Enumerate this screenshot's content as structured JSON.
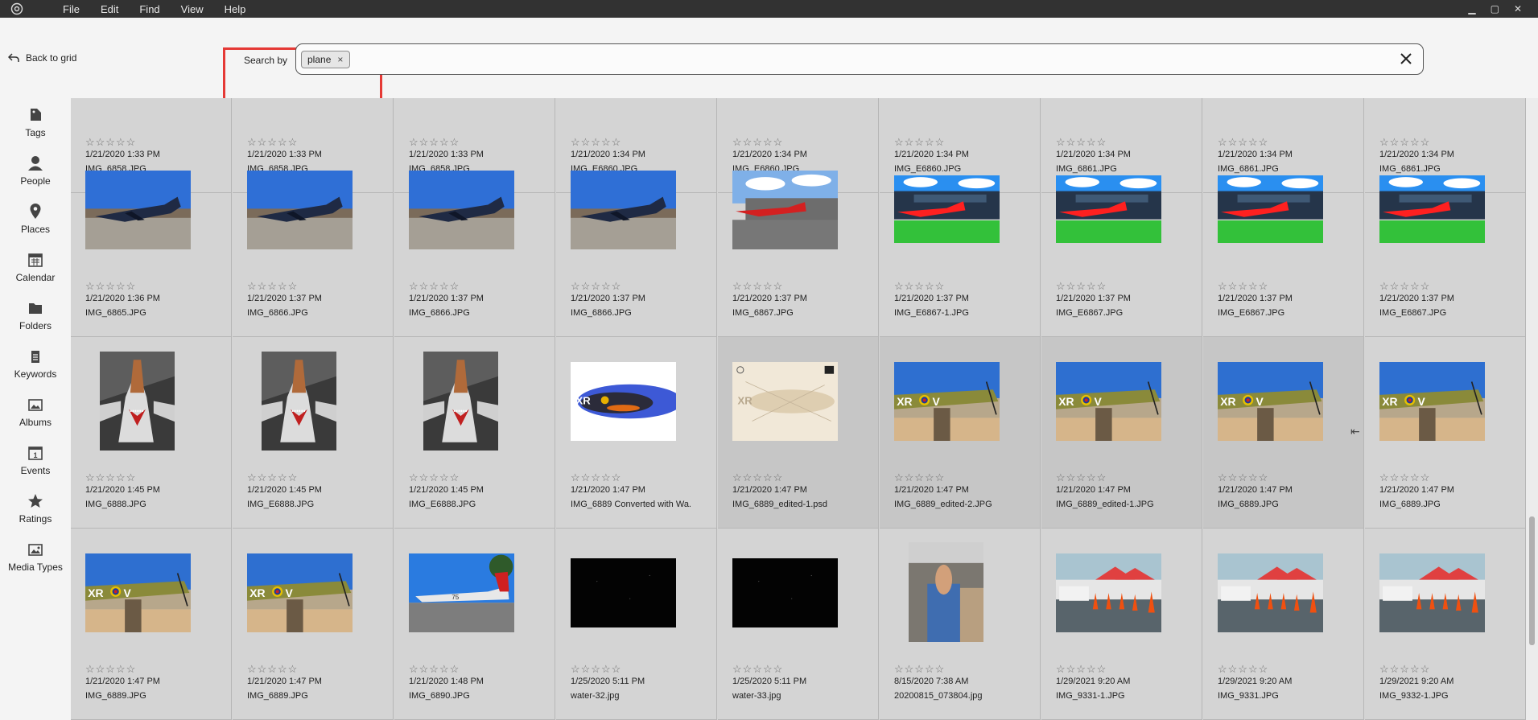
{
  "menu": [
    "File",
    "Edit",
    "Find",
    "View",
    "Help"
  ],
  "toolbar": {
    "back_label": "Back to grid",
    "search_by_label": "Search by"
  },
  "search": {
    "tag": "plane",
    "chip_remove": "×"
  },
  "sidebar": [
    {
      "label": "Tags",
      "icon": "tag-icon"
    },
    {
      "label": "People",
      "icon": "people-icon"
    },
    {
      "label": "Places",
      "icon": "map-pin-icon"
    },
    {
      "label": "Calendar",
      "icon": "calendar-icon"
    },
    {
      "label": "Folders",
      "icon": "folder-icon"
    },
    {
      "label": "Keywords",
      "icon": "keyword-icon"
    },
    {
      "label": "Albums",
      "icon": "album-icon"
    },
    {
      "label": "Events",
      "icon": "events-icon"
    },
    {
      "label": "Ratings",
      "icon": "star-icon"
    },
    {
      "label": "Media Types",
      "icon": "media-types-icon"
    }
  ],
  "rating_stars": "☆☆☆☆☆",
  "colors": {
    "accent_red": "#e53935",
    "menubar": "#323232",
    "grid_bg": "#d4d4d4"
  },
  "photos": [
    {
      "date": "1/21/2020 1:33 PM",
      "name": "IMG_6858.JPG",
      "thumb": "none"
    },
    {
      "date": "1/21/2020 1:33 PM",
      "name": "IMG_6858.JPG",
      "thumb": "none"
    },
    {
      "date": "1/21/2020 1:33 PM",
      "name": "IMG_6858.JPG",
      "thumb": "none"
    },
    {
      "date": "1/21/2020 1:34 PM",
      "name": "IMG_E6860.JPG",
      "thumb": "none"
    },
    {
      "date": "1/21/2020 1:34 PM",
      "name": "IMG_E6860.JPG",
      "thumb": "none"
    },
    {
      "date": "1/21/2020 1:34 PM",
      "name": "IMG_E6860.JPG",
      "thumb": "none"
    },
    {
      "date": "1/21/2020 1:34 PM",
      "name": "IMG_6861.JPG",
      "thumb": "none"
    },
    {
      "date": "1/21/2020 1:34 PM",
      "name": "IMG_6861.JPG",
      "thumb": "none"
    },
    {
      "date": "1/21/2020 1:34 PM",
      "name": "IMG_6861.JPG",
      "thumb": "none"
    },
    {
      "date": "1/21/2020 1:36 PM",
      "name": "IMG_6865.JPG",
      "thumb": "navy-jet"
    },
    {
      "date": "1/21/2020 1:37 PM",
      "name": "IMG_6866.JPG",
      "thumb": "navy-jet"
    },
    {
      "date": "1/21/2020 1:37 PM",
      "name": "IMG_6866.JPG",
      "thumb": "navy-jet"
    },
    {
      "date": "1/21/2020 1:37 PM",
      "name": "IMG_6866.JPG",
      "thumb": "navy-jet"
    },
    {
      "date": "1/21/2020 1:37 PM",
      "name": "IMG_6867.JPG",
      "thumb": "red-jet"
    },
    {
      "date": "1/21/2020 1:37 PM",
      "name": "IMG_E6867-1.JPG",
      "thumb": "red-jet-vivid"
    },
    {
      "date": "1/21/2020 1:37 PM",
      "name": "IMG_E6867.JPG",
      "thumb": "red-jet-vivid"
    },
    {
      "date": "1/21/2020 1:37 PM",
      "name": "IMG_E6867.JPG",
      "thumb": "red-jet-vivid"
    },
    {
      "date": "1/21/2020 1:37 PM",
      "name": "IMG_E6867.JPG",
      "thumb": "red-jet-vivid"
    },
    {
      "date": "1/21/2020 1:45 PM",
      "name": "IMG_6888.JPG",
      "thumb": "sharkmouth"
    },
    {
      "date": "1/21/2020 1:45 PM",
      "name": "IMG_E6888.JPG",
      "thumb": "sharkmouth"
    },
    {
      "date": "1/21/2020 1:45 PM",
      "name": "IMG_E6888.JPG",
      "thumb": "sharkmouth"
    },
    {
      "date": "1/21/2020 1:47 PM",
      "name": "IMG_6889 Converted with Wa.",
      "thumb": "watercolor-blue"
    },
    {
      "date": "1/21/2020 1:47 PM",
      "name": "IMG_6889_edited-1.psd",
      "thumb": "sketch"
    },
    {
      "date": "1/21/2020 1:47 PM",
      "name": "IMG_6889_edited-2.JPG",
      "thumb": "spitfire"
    },
    {
      "date": "1/21/2020 1:47 PM",
      "name": "IMG_6889_edited-1.JPG",
      "thumb": "spitfire"
    },
    {
      "date": "1/21/2020 1:47 PM",
      "name": "IMG_6889.JPG",
      "thumb": "spitfire"
    },
    {
      "date": "1/21/2020 1:47 PM",
      "name": "IMG_6889.JPG",
      "thumb": "spitfire"
    },
    {
      "date": "1/21/2020 1:47 PM",
      "name": "IMG_6889.JPG",
      "thumb": "spitfire"
    },
    {
      "date": "1/21/2020 1:47 PM",
      "name": "IMG_6889.JPG",
      "thumb": "spitfire"
    },
    {
      "date": "1/21/2020 1:48 PM",
      "name": "IMG_6890.JPG",
      "thumb": "mustang"
    },
    {
      "date": "1/25/2020 5:11 PM",
      "name": "water-32.jpg",
      "thumb": "dark"
    },
    {
      "date": "1/25/2020 5:11 PM",
      "name": "water-33.jpg",
      "thumb": "dark"
    },
    {
      "date": "8/15/2020 7:38 AM",
      "name": "20200815_073804.jpg",
      "thumb": "car-interior"
    },
    {
      "date": "1/29/2021 9:20 AM",
      "name": "IMG_9331-1.JPG",
      "thumb": "cones"
    },
    {
      "date": "1/29/2021 9:20 AM",
      "name": "IMG_9331.JPG",
      "thumb": "cones"
    },
    {
      "date": "1/29/2021 9:20 AM",
      "name": "IMG_9332-1.JPG",
      "thumb": "cones"
    }
  ]
}
